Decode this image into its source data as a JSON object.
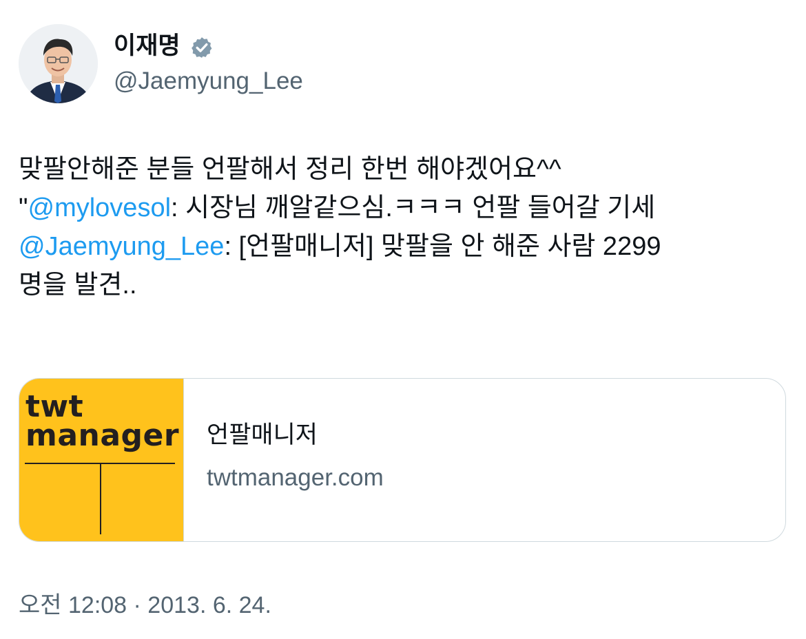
{
  "author": {
    "display_name": "이재명",
    "handle": "@Jaemyung_Lee",
    "verified": true,
    "avatar_icon": "profile-photo"
  },
  "tweet": {
    "lines": [
      [
        {
          "text": "맞팔안해준 분들 언팔해서 정리 한번 해야겠어요^^",
          "mention": false
        }
      ],
      [
        {
          "text": "\"",
          "mention": false
        },
        {
          "text": "@mylovesol",
          "mention": true
        },
        {
          "text": ": 시장님 깨알같으심.ㅋㅋㅋ 언팔 들어갈 기세",
          "mention": false
        }
      ],
      [
        {
          "text": "@Jaemyung_Lee",
          "mention": true
        },
        {
          "text": ": [언팔매니저] 맞팔을 안 해준 사람 2299",
          "mention": false
        }
      ],
      [
        {
          "text": "명을 발견..",
          "mention": false
        }
      ]
    ]
  },
  "card": {
    "thumb_line1": "twt",
    "thumb_line2": "manager",
    "title": "언팔매니저",
    "domain": "twtmanager.com",
    "thumb_color": "#ffc21c"
  },
  "timestamp": "오전 12:08 · 2013. 6. 24.",
  "colors": {
    "mention": "#1d9bf0",
    "secondary_text": "#536471",
    "primary_text": "#0f1419",
    "border": "#cfd9de",
    "verified_badge": "#829aab"
  }
}
